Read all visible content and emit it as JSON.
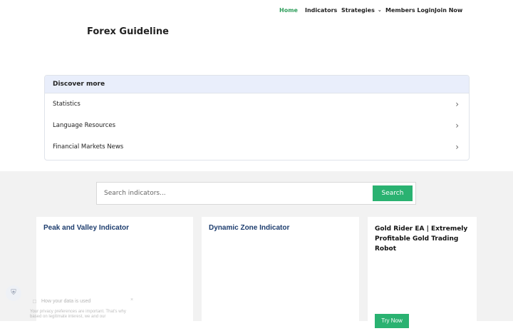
{
  "nav": {
    "home": "Home",
    "indicators": "Indicators",
    "strategies": "Strategies",
    "members_login": "Members Login",
    "join_now": "Join Now",
    "active_color": "#2e9e5b"
  },
  "site": {
    "title": "Forex Guideline"
  },
  "discover": {
    "heading": "Discover more",
    "items": [
      {
        "label": "Statistics"
      },
      {
        "label": "Language Resources"
      },
      {
        "label": "Financial Markets News"
      }
    ]
  },
  "search": {
    "placeholder": "Search indicators...",
    "button": "Search",
    "button_color": "#2ab271"
  },
  "cards": [
    {
      "title": "Peak and Valley Indicator"
    },
    {
      "title": "Dynamic Zone Indicator"
    },
    {
      "title": "Gold Rider EA | Extremely Profitable Gold Trading Robot",
      "button": "Try Now"
    }
  ],
  "privacy": {
    "title": "How your data is used",
    "text": "Your privacy preferences are important. That's why based on legitimate interest, we and our"
  },
  "icons": {
    "chevron": "chevron-down-icon",
    "arrow": "chevron-right-icon",
    "shield": "shield-icon",
    "lock": "lock-icon",
    "close": "close-icon"
  }
}
